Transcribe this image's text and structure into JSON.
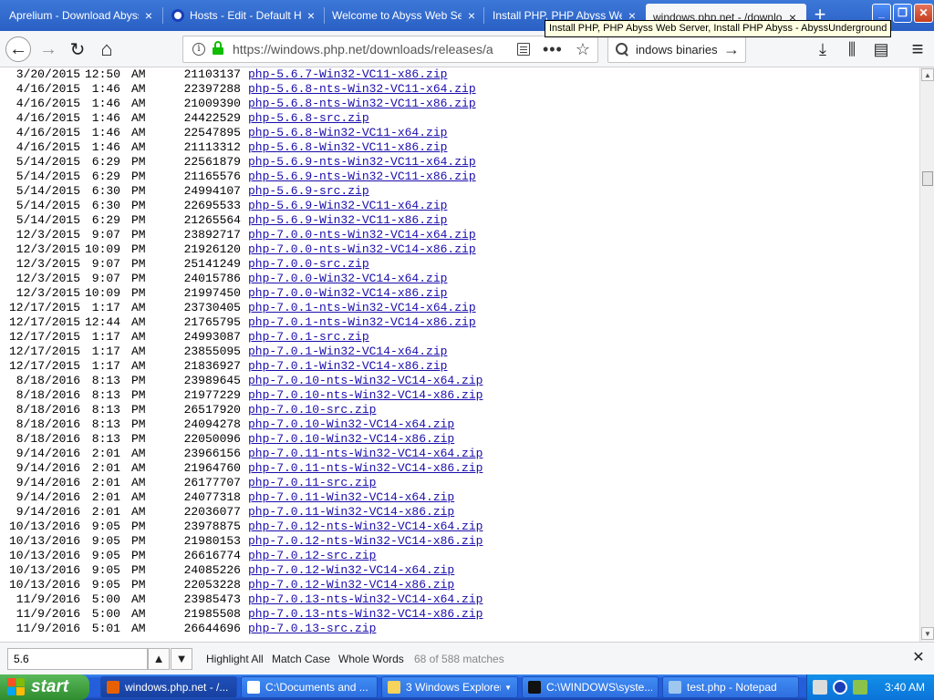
{
  "tabs": [
    {
      "title": "Aprelium - Download Abyss W",
      "close": "×"
    },
    {
      "title": "Hosts - Edit - Default Ho",
      "close": "×"
    },
    {
      "title": "Welcome to Abyss Web Serv",
      "close": "×"
    },
    {
      "title": "Install PHP, PHP Abyss Web",
      "close": "×"
    },
    {
      "title": "windows.php.net - /downloa",
      "close": "×"
    }
  ],
  "newtab_label": "+",
  "window_buttons": {
    "minimize": "_",
    "restore": "❐",
    "close": "✕"
  },
  "tooltip": "Install PHP, PHP Abyss Web Server, Install PHP Abyss - AbyssUnderground",
  "nav": {
    "back": "←",
    "forward": "→",
    "reload": "↻",
    "home": "⌂",
    "url": "https://windows.php.net/downloads/releases/a",
    "page_actions": "•••",
    "bookmark": "☆",
    "search_text": "indows binaries",
    "search_go": "→",
    "downloads": "⤓",
    "library": "⫼",
    "sidebar": "▤",
    "menu": "≡"
  },
  "listing": [
    {
      "date": "3/20/2015",
      "time": "12:50",
      "ampm": "AM",
      "size": "21103137",
      "file": "php-5.6.7-Win32-VC11-x86.zip"
    },
    {
      "date": "4/16/2015",
      "time": "1:46",
      "ampm": "AM",
      "size": "22397288",
      "file": "php-5.6.8-nts-Win32-VC11-x64.zip"
    },
    {
      "date": "4/16/2015",
      "time": "1:46",
      "ampm": "AM",
      "size": "21009390",
      "file": "php-5.6.8-nts-Win32-VC11-x86.zip"
    },
    {
      "date": "4/16/2015",
      "time": "1:46",
      "ampm": "AM",
      "size": "24422529",
      "file": "php-5.6.8-src.zip"
    },
    {
      "date": "4/16/2015",
      "time": "1:46",
      "ampm": "AM",
      "size": "22547895",
      "file": "php-5.6.8-Win32-VC11-x64.zip"
    },
    {
      "date": "4/16/2015",
      "time": "1:46",
      "ampm": "AM",
      "size": "21113312",
      "file": "php-5.6.8-Win32-VC11-x86.zip"
    },
    {
      "date": "5/14/2015",
      "time": "6:29",
      "ampm": "PM",
      "size": "22561879",
      "file": "php-5.6.9-nts-Win32-VC11-x64.zip"
    },
    {
      "date": "5/14/2015",
      "time": "6:29",
      "ampm": "PM",
      "size": "21165576",
      "file": "php-5.6.9-nts-Win32-VC11-x86.zip"
    },
    {
      "date": "5/14/2015",
      "time": "6:30",
      "ampm": "PM",
      "size": "24994107",
      "file": "php-5.6.9-src.zip"
    },
    {
      "date": "5/14/2015",
      "time": "6:30",
      "ampm": "PM",
      "size": "22695533",
      "file": "php-5.6.9-Win32-VC11-x64.zip"
    },
    {
      "date": "5/14/2015",
      "time": "6:29",
      "ampm": "PM",
      "size": "21265564",
      "file": "php-5.6.9-Win32-VC11-x86.zip"
    },
    {
      "date": "12/3/2015",
      "time": "9:07",
      "ampm": "PM",
      "size": "23892717",
      "file": "php-7.0.0-nts-Win32-VC14-x64.zip"
    },
    {
      "date": "12/3/2015",
      "time": "10:09",
      "ampm": "PM",
      "size": "21926120",
      "file": "php-7.0.0-nts-Win32-VC14-x86.zip"
    },
    {
      "date": "12/3/2015",
      "time": "9:07",
      "ampm": "PM",
      "size": "25141249",
      "file": "php-7.0.0-src.zip"
    },
    {
      "date": "12/3/2015",
      "time": "9:07",
      "ampm": "PM",
      "size": "24015786",
      "file": "php-7.0.0-Win32-VC14-x64.zip"
    },
    {
      "date": "12/3/2015",
      "time": "10:09",
      "ampm": "PM",
      "size": "21997450",
      "file": "php-7.0.0-Win32-VC14-x86.zip"
    },
    {
      "date": "12/17/2015",
      "time": "1:17",
      "ampm": "AM",
      "size": "23730405",
      "file": "php-7.0.1-nts-Win32-VC14-x64.zip"
    },
    {
      "date": "12/17/2015",
      "time": "12:44",
      "ampm": "AM",
      "size": "21765795",
      "file": "php-7.0.1-nts-Win32-VC14-x86.zip"
    },
    {
      "date": "12/17/2015",
      "time": "1:17",
      "ampm": "AM",
      "size": "24993087",
      "file": "php-7.0.1-src.zip"
    },
    {
      "date": "12/17/2015",
      "time": "1:17",
      "ampm": "AM",
      "size": "23855095",
      "file": "php-7.0.1-Win32-VC14-x64.zip"
    },
    {
      "date": "12/17/2015",
      "time": "1:17",
      "ampm": "AM",
      "size": "21836927",
      "file": "php-7.0.1-Win32-VC14-x86.zip"
    },
    {
      "date": "8/18/2016",
      "time": "8:13",
      "ampm": "PM",
      "size": "23989645",
      "file": "php-7.0.10-nts-Win32-VC14-x64.zip"
    },
    {
      "date": "8/18/2016",
      "time": "8:13",
      "ampm": "PM",
      "size": "21977229",
      "file": "php-7.0.10-nts-Win32-VC14-x86.zip"
    },
    {
      "date": "8/18/2016",
      "time": "8:13",
      "ampm": "PM",
      "size": "26517920",
      "file": "php-7.0.10-src.zip"
    },
    {
      "date": "8/18/2016",
      "time": "8:13",
      "ampm": "PM",
      "size": "24094278",
      "file": "php-7.0.10-Win32-VC14-x64.zip"
    },
    {
      "date": "8/18/2016",
      "time": "8:13",
      "ampm": "PM",
      "size": "22050096",
      "file": "php-7.0.10-Win32-VC14-x86.zip"
    },
    {
      "date": "9/14/2016",
      "time": "2:01",
      "ampm": "AM",
      "size": "23966156",
      "file": "php-7.0.11-nts-Win32-VC14-x64.zip"
    },
    {
      "date": "9/14/2016",
      "time": "2:01",
      "ampm": "AM",
      "size": "21964760",
      "file": "php-7.0.11-nts-Win32-VC14-x86.zip"
    },
    {
      "date": "9/14/2016",
      "time": "2:01",
      "ampm": "AM",
      "size": "26177707",
      "file": "php-7.0.11-src.zip"
    },
    {
      "date": "9/14/2016",
      "time": "2:01",
      "ampm": "AM",
      "size": "24077318",
      "file": "php-7.0.11-Win32-VC14-x64.zip"
    },
    {
      "date": "9/14/2016",
      "time": "2:01",
      "ampm": "AM",
      "size": "22036077",
      "file": "php-7.0.11-Win32-VC14-x86.zip"
    },
    {
      "date": "10/13/2016",
      "time": "9:05",
      "ampm": "PM",
      "size": "23978875",
      "file": "php-7.0.12-nts-Win32-VC14-x64.zip"
    },
    {
      "date": "10/13/2016",
      "time": "9:05",
      "ampm": "PM",
      "size": "21980153",
      "file": "php-7.0.12-nts-Win32-VC14-x86.zip"
    },
    {
      "date": "10/13/2016",
      "time": "9:05",
      "ampm": "PM",
      "size": "26616774",
      "file": "php-7.0.12-src.zip"
    },
    {
      "date": "10/13/2016",
      "time": "9:05",
      "ampm": "PM",
      "size": "24085226",
      "file": "php-7.0.12-Win32-VC14-x64.zip"
    },
    {
      "date": "10/13/2016",
      "time": "9:05",
      "ampm": "PM",
      "size": "22053228",
      "file": "php-7.0.12-Win32-VC14-x86.zip"
    },
    {
      "date": "11/9/2016",
      "time": "5:00",
      "ampm": "AM",
      "size": "23985473",
      "file": "php-7.0.13-nts-Win32-VC14-x64.zip"
    },
    {
      "date": "11/9/2016",
      "time": "5:00",
      "ampm": "AM",
      "size": "21985508",
      "file": "php-7.0.13-nts-Win32-VC14-x86.zip"
    },
    {
      "date": "11/9/2016",
      "time": "5:01",
      "ampm": "AM",
      "size": "26644696",
      "file": "php-7.0.13-src.zip"
    }
  ],
  "scrollbar": {
    "up": "▲",
    "down": "▼"
  },
  "findbar": {
    "query": "5.6",
    "prev": "▲",
    "next": "▼",
    "highlight_all": "Highlight All",
    "match_case": "Match Case",
    "whole_words": "Whole Words",
    "matches": "68 of 588 matches",
    "close": "✕"
  },
  "taskbar": {
    "start": "start",
    "tasks": [
      {
        "label": "windows.php.net - /...",
        "icon_color": "#e66000",
        "arrow": ""
      },
      {
        "label": "C:\\Documents and ...",
        "icon_color": "#ffffff",
        "arrow": ""
      },
      {
        "label": "3 Windows Explorer",
        "icon_color": "#f7d35c",
        "arrow": "▼"
      },
      {
        "label": "C:\\WINDOWS\\syste...",
        "icon_color": "#111111",
        "arrow": ""
      },
      {
        "label": "test.php - Notepad",
        "icon_color": "#9fc7ee",
        "arrow": ""
      }
    ],
    "clock": "3:40 AM"
  }
}
